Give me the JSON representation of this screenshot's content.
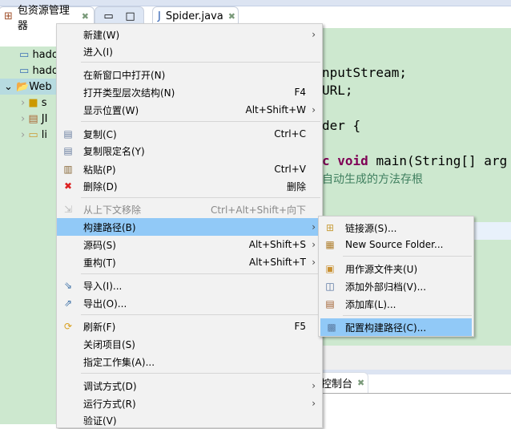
{
  "tabs": {
    "explorer": "包资源管理器",
    "editor": "Spider.java",
    "console": "控制台"
  },
  "tree": [
    "hado",
    "hado",
    "Web",
    "s",
    "JI",
    "li"
  ],
  "code": {
    "l1": "nputStream;",
    "l2": "URL;",
    "l3": "der {",
    "l4_kw1": "c",
    "l4_kw2": "void",
    "l4_rest": " main(String[] arg",
    "l5": "自动生成的方法存根"
  },
  "menu": [
    {
      "label": "新建(W)",
      "arrow": "›"
    },
    {
      "label": "进入(I)"
    },
    {
      "label": "在新窗口中打开(N)"
    },
    {
      "label": "打开类型层次结构(N)",
      "shortcut": "F4"
    },
    {
      "label": "显示位置(W)",
      "shortcut": "Alt+Shift+W",
      "arrow": "›"
    },
    {
      "label": "复制(C)",
      "shortcut": "Ctrl+C"
    },
    {
      "label": "复制限定名(Y)"
    },
    {
      "label": "粘贴(P)",
      "shortcut": "Ctrl+V"
    },
    {
      "label": "删除(D)",
      "shortcut": "删除"
    },
    {
      "label": "从上下文移除",
      "shortcut": "Ctrl+Alt+Shift+向下"
    },
    {
      "label": "构建路径(B)",
      "arrow": "›"
    },
    {
      "label": "源码(S)",
      "shortcut": "Alt+Shift+S",
      "arrow": "›"
    },
    {
      "label": "重构(T)",
      "shortcut": "Alt+Shift+T",
      "arrow": "›"
    },
    {
      "label": "导入(I)..."
    },
    {
      "label": "导出(O)..."
    },
    {
      "label": "刷新(F)",
      "shortcut": "F5"
    },
    {
      "label": "关闭项目(S)"
    },
    {
      "label": "指定工作集(A)..."
    },
    {
      "label": "调试方式(D)",
      "arrow": "›"
    },
    {
      "label": "运行方式(R)",
      "arrow": "›"
    },
    {
      "label": "验证(V)"
    }
  ],
  "submenu": [
    {
      "label": "链接源(S)..."
    },
    {
      "label": "New Source Folder..."
    },
    {
      "label": "用作源文件夹(U)"
    },
    {
      "label": "添加外部归档(V)..."
    },
    {
      "label": "添加库(L)..."
    },
    {
      "label": "配置构建路径(C)..."
    }
  ],
  "colors": {
    "highlight": "#91c9f7",
    "editor_bg": "#cde8cf",
    "keyword": "#7f0055",
    "comment": "#3f7f5f"
  }
}
